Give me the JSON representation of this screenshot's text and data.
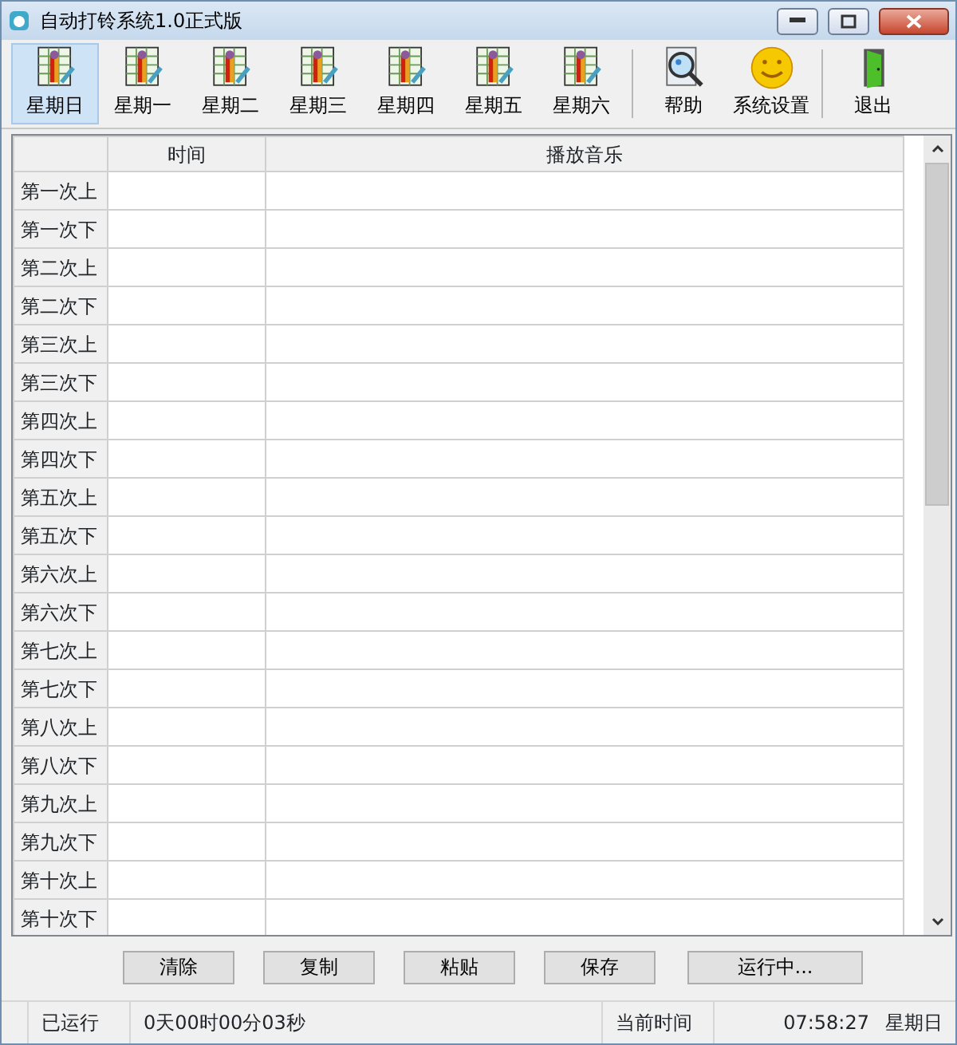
{
  "window": {
    "title": "自动打铃系统1.0正式版"
  },
  "toolbar": [
    {
      "kind": "day",
      "label": "星期日",
      "selected": true
    },
    {
      "kind": "day",
      "label": "星期一",
      "selected": false
    },
    {
      "kind": "day",
      "label": "星期二",
      "selected": false
    },
    {
      "kind": "day",
      "label": "星期三",
      "selected": false
    },
    {
      "kind": "day",
      "label": "星期四",
      "selected": false
    },
    {
      "kind": "day",
      "label": "星期五",
      "selected": false
    },
    {
      "kind": "day",
      "label": "星期六",
      "selected": false
    },
    {
      "kind": "help",
      "label": "帮助",
      "selected": false
    },
    {
      "kind": "settings",
      "label": "系统设置",
      "selected": false
    },
    {
      "kind": "exit",
      "label": "退出",
      "selected": false
    }
  ],
  "table": {
    "columns": [
      "时间",
      "播放音乐"
    ],
    "rows": [
      "第一次上",
      "第一次下",
      "第二次上",
      "第二次下",
      "第三次上",
      "第三次下",
      "第四次上",
      "第四次下",
      "第五次上",
      "第五次下",
      "第六次上",
      "第六次下",
      "第七次上",
      "第七次下",
      "第八次上",
      "第八次下",
      "第九次上",
      "第九次下",
      "第十次上",
      "第十次下"
    ]
  },
  "buttons": [
    "清除",
    "复制",
    "粘贴",
    "保存",
    "运行中..."
  ],
  "status_bar": {
    "elapsed_label": "已运行",
    "elapsed": "0天00时00分03秒",
    "time_label": "当前时间",
    "time": "07:58:27",
    "weekday": "星期日"
  }
}
